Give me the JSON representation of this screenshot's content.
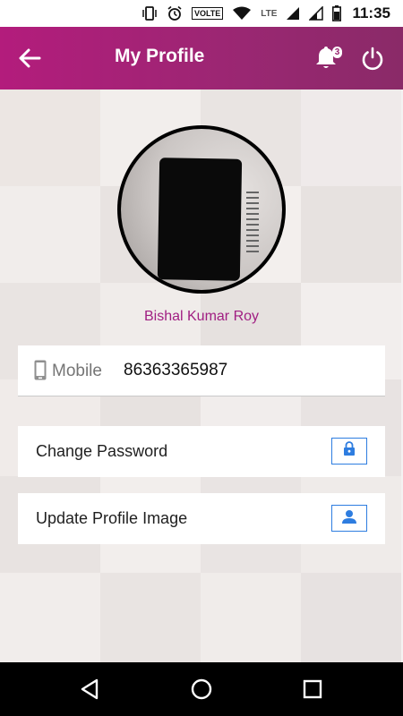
{
  "status_bar": {
    "volte": "VOLTE",
    "network": "LTE",
    "time": "11:35",
    "icons": [
      "vibrate-icon",
      "alarm-icon",
      "wifi-icon",
      "signal-icon",
      "signal-icon-2",
      "battery-icon"
    ]
  },
  "app_bar": {
    "title": "My Profile",
    "notification_count": "3",
    "background": "#9a2772",
    "icons": [
      "back-arrow-icon",
      "bell-icon",
      "power-icon"
    ]
  },
  "profile": {
    "name": "Bishal Kumar Roy",
    "name_color": "#a01e82"
  },
  "mobile": {
    "label": "Mobile",
    "value": "86363365987",
    "icon": "phone-icon"
  },
  "actions": {
    "change_password": {
      "label": "Change Password",
      "icon": "lock-icon"
    },
    "update_image": {
      "label": "Update Profile Image",
      "icon": "person-icon"
    },
    "accent": "#2e7de0"
  },
  "nav_bar": {
    "icons": [
      "nav-back-icon",
      "nav-home-icon",
      "nav-recents-icon"
    ]
  }
}
